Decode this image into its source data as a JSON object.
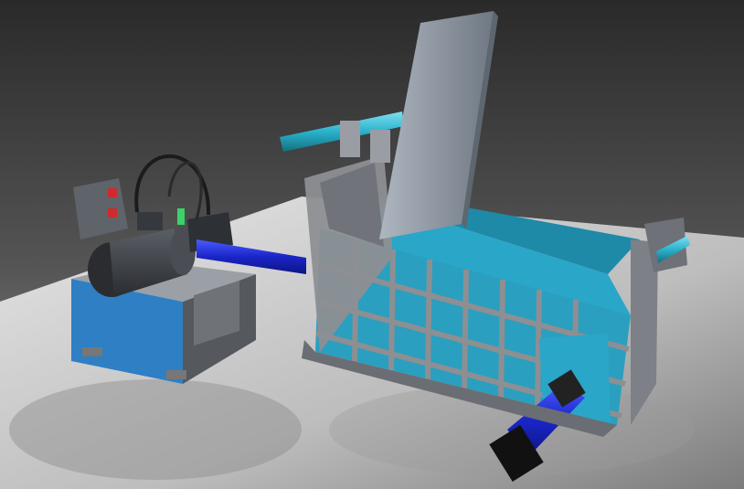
{
  "scene": {
    "subject": "",
    "colors": {
      "background_top": "#2e2e2e",
      "background_bottom": "#8a8a8a",
      "floor": "#d9d9d9",
      "frame_steel": "#8d8f93",
      "tank_blue": "#2f7fc4",
      "chamber_cyan": "#2aa6c8",
      "cylinder_blue": "#1f2fd0",
      "lid_gray": "#9aa3ad",
      "motor_dark": "#3c3f44"
    }
  }
}
